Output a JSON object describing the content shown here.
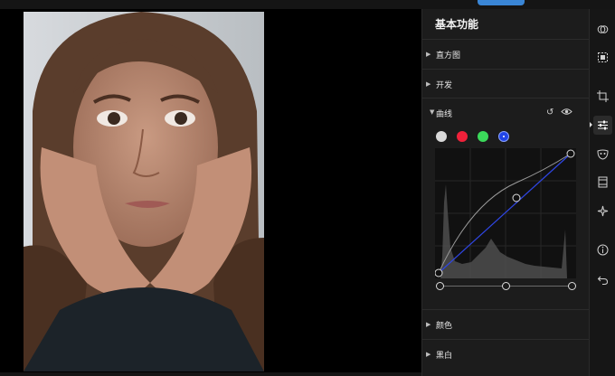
{
  "panel": {
    "title": "基本功能",
    "sections": {
      "histogram": "直方图",
      "levels": "开发",
      "curves": "曲线",
      "color": "颜色",
      "bw": "黑白"
    },
    "curves": {
      "channels": [
        "white",
        "red",
        "green",
        "blue"
      ],
      "active_channel": "blue",
      "channel_colors": {
        "white": "#d9d9d9",
        "red": "#f0213a",
        "green": "#3bd95a",
        "blue": "#2145e8"
      }
    }
  },
  "toolbar": {
    "icons": [
      "overlap-circles-icon",
      "select-area-icon",
      "crop-icon",
      "adjust-sliders-icon",
      "mask-icon",
      "frame-icon",
      "magic-sparkle-icon",
      "info-icon",
      "undo-icon"
    ],
    "active": "adjust-sliders-icon"
  },
  "colors": {
    "panel_bg": "#1c1c1c",
    "accent": "#3a86d6"
  }
}
